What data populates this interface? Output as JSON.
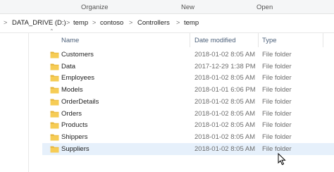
{
  "ribbon": {
    "organize": "Organize",
    "new": "New",
    "open": "Open"
  },
  "breadcrumb": [
    "DATA_DRIVE (D:)",
    "temp",
    "contoso",
    "Controllers",
    "temp"
  ],
  "columns": {
    "name": "Name",
    "date": "Date modified",
    "type": "Type"
  },
  "folders": [
    {
      "name": "Customers",
      "date": "2018-01-02 8:05 AM",
      "type": "File folder"
    },
    {
      "name": "Data",
      "date": "2017-12-29 1:38 PM",
      "type": "File folder"
    },
    {
      "name": "Employees",
      "date": "2018-01-02 8:05 AM",
      "type": "File folder"
    },
    {
      "name": "Models",
      "date": "2018-01-01 6:06 PM",
      "type": "File folder"
    },
    {
      "name": "OrderDetails",
      "date": "2018-01-02 8:05 AM",
      "type": "File folder"
    },
    {
      "name": "Orders",
      "date": "2018-01-02 8:05 AM",
      "type": "File folder"
    },
    {
      "name": "Products",
      "date": "2018-01-02 8:05 AM",
      "type": "File folder"
    },
    {
      "name": "Shippers",
      "date": "2018-01-02 8:05 AM",
      "type": "File folder"
    },
    {
      "name": "Suppliers",
      "date": "2018-01-02 8:05 AM",
      "type": "File folder"
    }
  ],
  "colors": {
    "folder": "#f6cc55",
    "folder_dark": "#e4b43a",
    "selection": "#e6f0fb",
    "header_text": "#4c607a"
  }
}
